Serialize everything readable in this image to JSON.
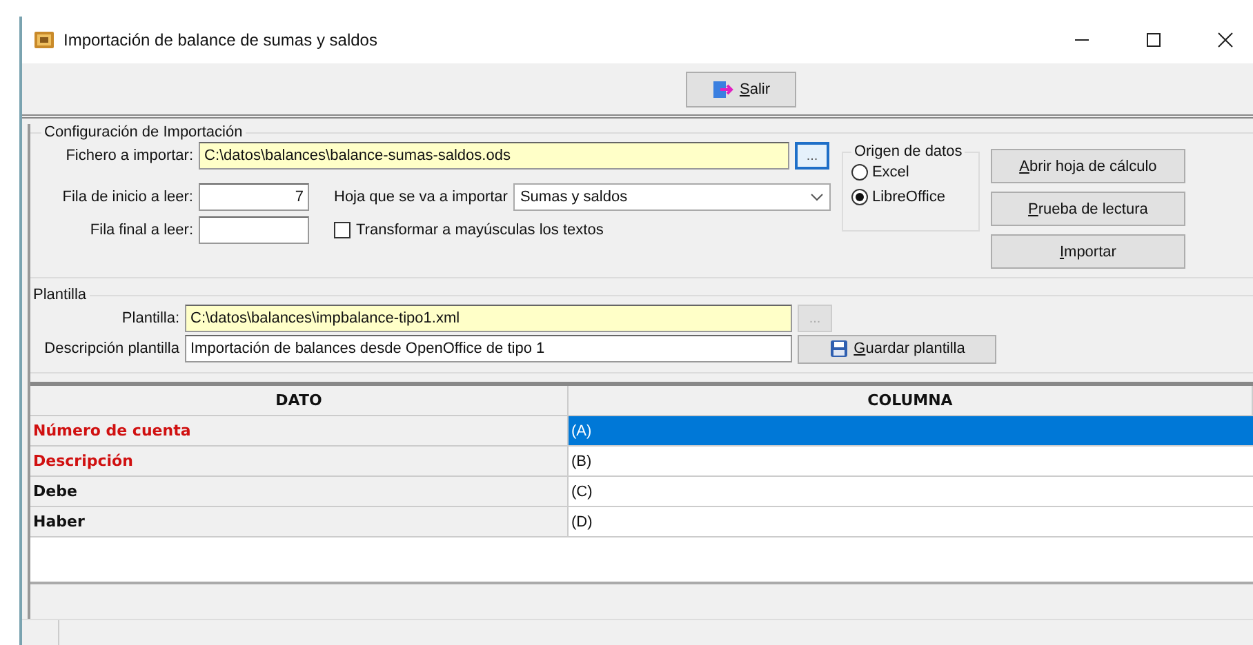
{
  "window": {
    "title": "Importación de balance de sumas y saldos"
  },
  "toolbar": {
    "exit_button": {
      "label": "Salir",
      "underline_first": true
    }
  },
  "config": {
    "title": "Configuración de Importación",
    "file": {
      "label": "Fichero a importar:",
      "value": "C:\\datos\\balances\\balance-sumas-saldos.ods",
      "browse": "..."
    },
    "start_row": {
      "label": "Fila de inicio a leer:",
      "value": "7"
    },
    "end_row": {
      "label": "Fila final a leer:"
    },
    "sheet": {
      "label": "Hoja que se va a importar",
      "value": "Sumas y saldos"
    },
    "uppercase": {
      "label": "Transformar a mayúsculas los textos",
      "checked": false
    },
    "source": {
      "title": "Origen de datos",
      "options": [
        {
          "label": "Excel",
          "selected": false
        },
        {
          "label": "LibreOffice",
          "selected": true
        }
      ]
    },
    "buttons": [
      {
        "label": "Abrir hoja de cálculo",
        "underline_first": true
      },
      {
        "label": "Prueba de lectura",
        "underline_first": true
      },
      {
        "label": "Importar",
        "underline_first": true
      }
    ]
  },
  "template": {
    "title": "Plantilla",
    "file": {
      "label": "Plantilla:",
      "value": "C:\\datos\\balances\\impbalance-tipo1.xml",
      "browse": "...",
      "disabled": true
    },
    "description": {
      "label": "Descripción plantilla",
      "value": "Importación de balances desde OpenOffice de tipo 1"
    },
    "save_button": {
      "label": "Guardar plantilla",
      "underline_first": true
    }
  },
  "table": {
    "columns": [
      "DATO",
      "COLUMNA"
    ],
    "rows": [
      {
        "dato": "Número de cuenta",
        "columna": "(A)",
        "required": true,
        "selected": true
      },
      {
        "dato": "Descripción",
        "columna": "(B)",
        "required": true,
        "selected": false
      },
      {
        "dato": "Debe",
        "columna": "(C)",
        "required": false,
        "selected": false
      },
      {
        "dato": "Haber",
        "columna": "(D)",
        "required": false,
        "selected": false
      }
    ]
  }
}
